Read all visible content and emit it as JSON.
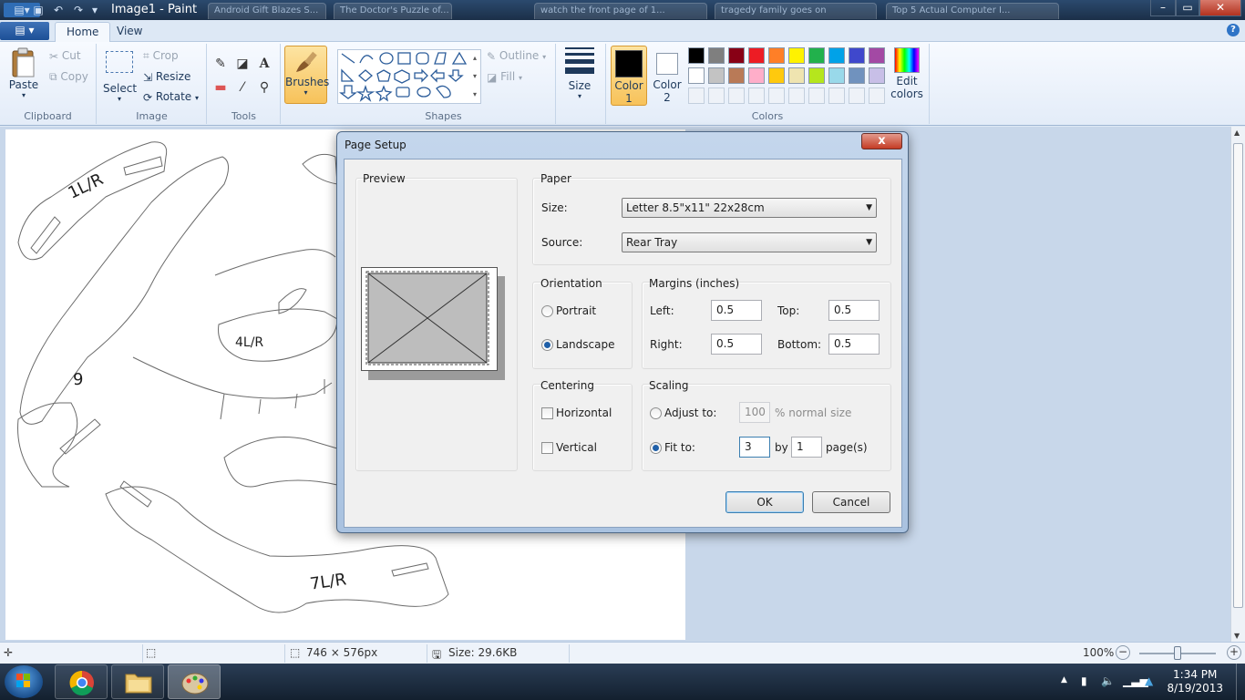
{
  "window": {
    "title": "Image1 - Paint",
    "background_tabs": [
      "Android Gift Blazes S...",
      "The Doctor's Puzzle of...",
      "watch the front page of 1...",
      "tragedy family goes on",
      "Top 5 Actual Computer I..."
    ]
  },
  "ribbon": {
    "tabs": [
      {
        "label": "Home",
        "active": true
      },
      {
        "label": "View",
        "active": false
      }
    ],
    "help_symbol": "?",
    "clipboard": {
      "paste": "Paste",
      "cut": "Cut",
      "copy": "Copy",
      "group": "Clipboard"
    },
    "image": {
      "select": "Select",
      "crop": "Crop",
      "resize": "Resize",
      "rotate": "Rotate",
      "group": "Image"
    },
    "tools": {
      "group": "Tools"
    },
    "brushes": "Brushes",
    "shapes": {
      "outline": "Outline",
      "fill": "Fill",
      "group": "Shapes"
    },
    "size": "Size",
    "color1": {
      "label": "Color",
      "num": "1",
      "value": "#000000"
    },
    "color2": {
      "label": "Color",
      "num": "2",
      "value": "#ffffff"
    },
    "colors_group": "Colors",
    "edit_colors": {
      "line1": "Edit",
      "line2": "colors"
    },
    "palette": [
      [
        "#000000",
        "#7f7f7f",
        "#880015",
        "#ed1c24",
        "#ff7f27",
        "#fff200",
        "#22b14c",
        "#00a2e8",
        "#3f48cc",
        "#a349a4"
      ],
      [
        "#ffffff",
        "#c3c3c3",
        "#b97a57",
        "#ffaec9",
        "#ffc90e",
        "#efe4b0",
        "#b5e61d",
        "#99d9ea",
        "#7092be",
        "#c8bfe7"
      ]
    ]
  },
  "canvas": {
    "labels": [
      "1L/R",
      "4L/R",
      "9",
      "7L/R"
    ]
  },
  "statusbar": {
    "dimensions": "746 × 576px",
    "size": "Size: 29.6KB",
    "zoom": "100%"
  },
  "taskbar": {
    "time": "1:34 PM",
    "date": "8/19/2013"
  },
  "dialog": {
    "title": "Page Setup",
    "close_symbol": "x",
    "preview_label": "Preview",
    "paper": {
      "label": "Paper",
      "size_label": "Size:",
      "size_value": "Letter 8.5\"x11\" 22x28cm",
      "source_label": "Source:",
      "source_value": "Rear Tray"
    },
    "orientation": {
      "label": "Orientation",
      "portrait": "Portrait",
      "landscape": "Landscape",
      "selected": "landscape"
    },
    "margins": {
      "label": "Margins (inches)",
      "left_label": "Left:",
      "left": "0.5",
      "top_label": "Top:",
      "top": "0.5",
      "right_label": "Right:",
      "right": "0.5",
      "bottom_label": "Bottom:",
      "bottom": "0.5"
    },
    "centering": {
      "label": "Centering",
      "horizontal": "Horizontal",
      "vertical": "Vertical"
    },
    "scaling": {
      "label": "Scaling",
      "adjust_label": "Adjust to:",
      "adjust_value": "100",
      "normal_size": "% normal size",
      "fit_label": "Fit to:",
      "fit_value": "3",
      "by": "by",
      "pages_value": "1",
      "pages_suffix": "page(s)",
      "selected": "fit"
    },
    "ok": "OK",
    "cancel": "Cancel"
  }
}
